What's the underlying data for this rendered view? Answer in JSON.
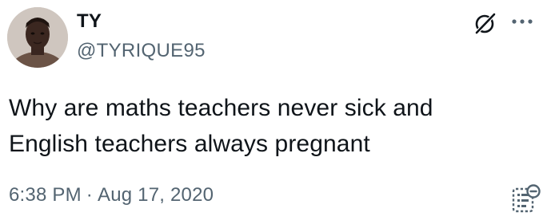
{
  "author": {
    "display_name": "TY",
    "handle": "@TYRIQUE95"
  },
  "tweet": {
    "text_lines": [
      "Why are maths teachers never sick and",
      "English teachers always pregnant"
    ],
    "time": "6:38 PM",
    "separator": "·",
    "date": "Aug 17, 2020"
  },
  "icons": {
    "header_action": "grok-icon",
    "menu": "more-horizontal-icon",
    "footer_action": "community-note-icon"
  },
  "colors": {
    "text_primary": "#0f1419",
    "text_secondary": "#536471"
  }
}
